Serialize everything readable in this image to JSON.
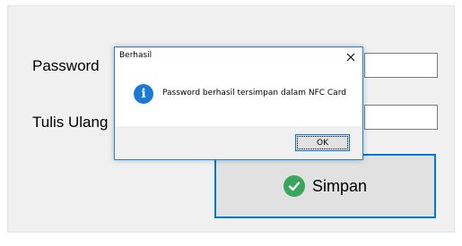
{
  "form": {
    "password_label": "Password",
    "retype_label": "Tulis Ulang",
    "password_value": "",
    "retype_value": "",
    "save_button_label": "Simpan",
    "save_icon": "check-circle-icon"
  },
  "dialog": {
    "title": "Berhasil",
    "close_glyph": "✕",
    "info_glyph": "i",
    "message": "Password berhasil tersimpan dalam NFC Card",
    "ok_label": "OK"
  },
  "colors": {
    "accent": "#0078d7",
    "info_icon": "#1a7ad4",
    "check_icon": "#3aa55c"
  }
}
